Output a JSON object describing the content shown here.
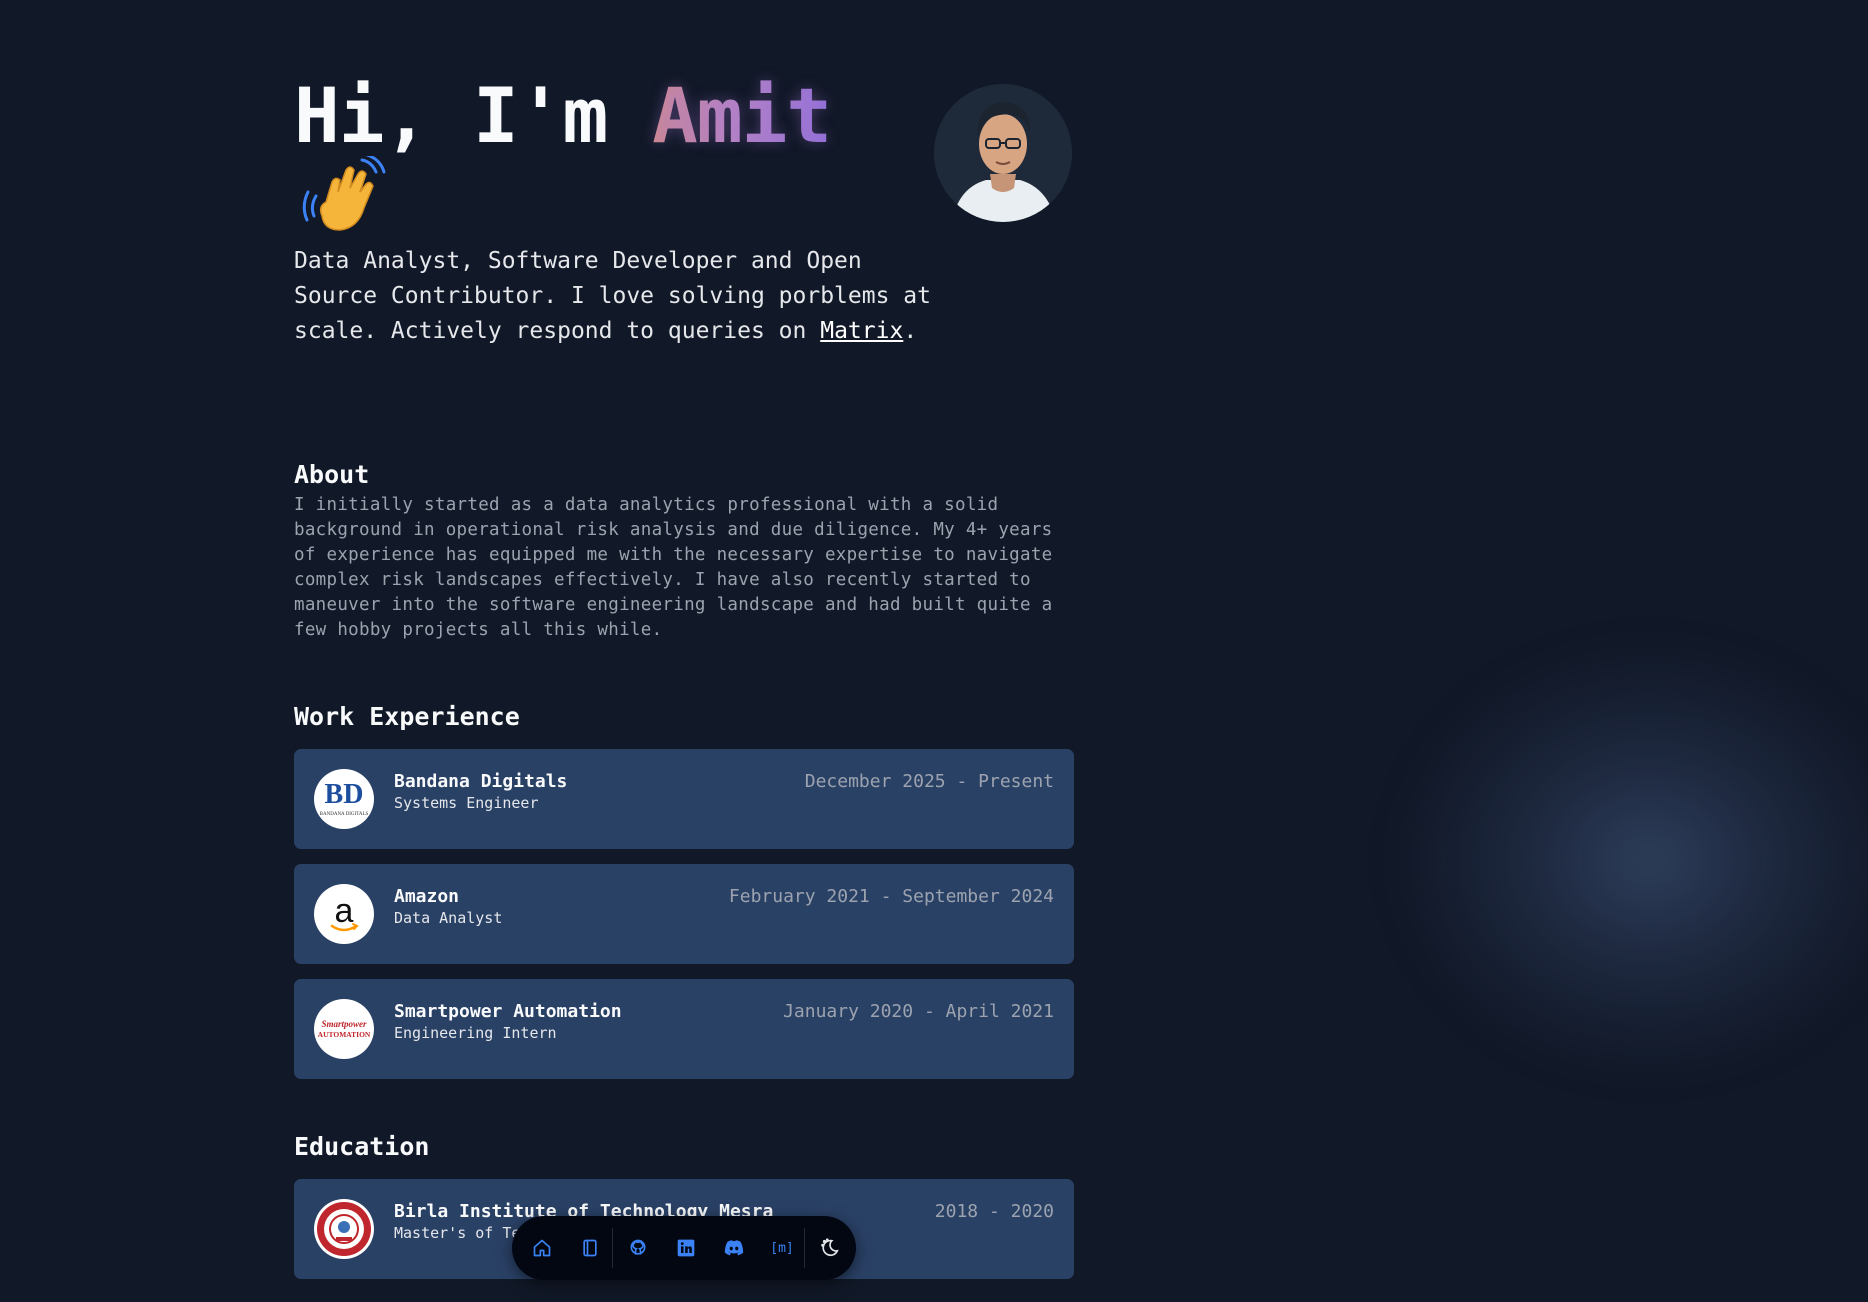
{
  "hero": {
    "greeting": "Hi, I'm",
    "name": "Amit",
    "tagline_text": "Data Analyst, Software Developer and Open Source Contributor. I love solving porblems at scale. Actively respond to queries on",
    "tagline_link": "Matrix",
    "tagline_end": "."
  },
  "about": {
    "title": "About",
    "text": "I initially started as a data analytics professional with a solid background in operational risk analysis and due diligence. My 4+ years of experience has equipped me with the necessary expertise to navigate complex risk landscapes effectively. I have also recently started to maneuver into the software engineering landscape and had built quite a few hobby projects all this while."
  },
  "work": {
    "title": "Work Experience",
    "items": [
      {
        "company": "Bandana Digitals",
        "role": "Systems Engineer",
        "dates": "December 2025 - Present"
      },
      {
        "company": "Amazon",
        "role": "Data Analyst",
        "dates": "February 2021 - September 2024"
      },
      {
        "company": "Smartpower Automation",
        "role": "Engineering Intern",
        "dates": "January 2020 - April 2021"
      }
    ]
  },
  "education": {
    "title": "Education",
    "items": [
      {
        "school": "Birla Institute of Technology Mesra",
        "degree": "Master's of Technology in Electrical Engineering",
        "dates": "2018 - 2020"
      }
    ]
  },
  "logos": {
    "bandana": "BD",
    "bandana_sub": "BANDANA DIGITALS",
    "amazon": "a",
    "smartpower_top": "Smartpower",
    "smartpower_bottom": "AUTOMATION"
  },
  "dock": {
    "items": [
      "home-icon",
      "notebook-icon",
      "github-icon",
      "linkedin-icon",
      "discord-icon",
      "matrix-icon",
      "theme-toggle-icon"
    ],
    "matrix_glyph": "[m]"
  },
  "colors": {
    "background": "#111827",
    "card": "#2a4166",
    "accent_gradient_start": "#d08a8a",
    "accent_gradient_end": "#8f6fd6",
    "dock_icon": "#3b82f6"
  }
}
